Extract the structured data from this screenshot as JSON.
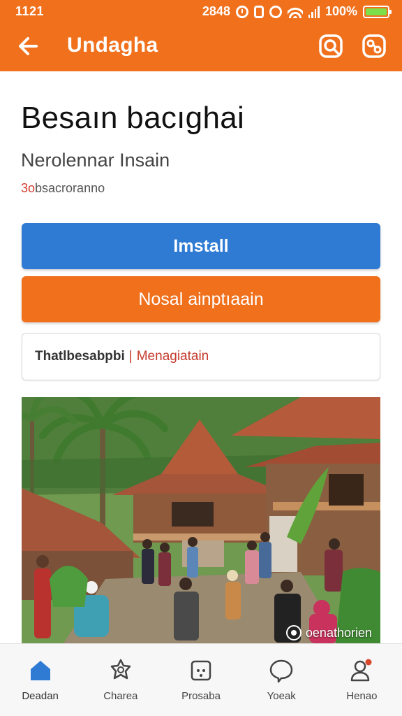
{
  "status": {
    "time": "1121",
    "clock": "2848",
    "battery_percent": "100%",
    "battery_level": 1.0,
    "icons": [
      "alarm-icon",
      "vibrate-icon",
      "dnd-icon",
      "wifi-icon",
      "signal-icon",
      "battery-icon"
    ]
  },
  "appbar": {
    "title": "Undagha",
    "back_icon": "back-arrow-icon",
    "search_icon": "search-icon",
    "share_icon": "share-icon"
  },
  "app": {
    "name": "Besaın bacıghai",
    "developer": "Nerolennar Insain",
    "meta_accent": "3o",
    "meta_rest": "bsacroranno"
  },
  "actions": {
    "install_label": "Imstall",
    "secondary_label": "Nosal ainptıaain"
  },
  "info_card": {
    "left": "Thatlbesabpbi",
    "separator": "|",
    "right": "Menagiatain"
  },
  "hero": {
    "caption": "oenathorien"
  },
  "bottom_nav": {
    "items": [
      {
        "label": "Deadan",
        "icon": "home-icon",
        "active": true
      },
      {
        "label": "Charea",
        "icon": "star-badge-icon",
        "active": false
      },
      {
        "label": "Prosaba",
        "icon": "dice-icon",
        "active": false
      },
      {
        "label": "Yoeak",
        "icon": "chat-bubble-icon",
        "active": false
      },
      {
        "label": "Henao",
        "icon": "profile-icon",
        "active": false
      }
    ]
  },
  "colors": {
    "brand_orange": "#f0701c",
    "install_blue": "#2f7bd4",
    "accent_red": "#c43a2b",
    "home_blue": "#2f7bd4"
  }
}
